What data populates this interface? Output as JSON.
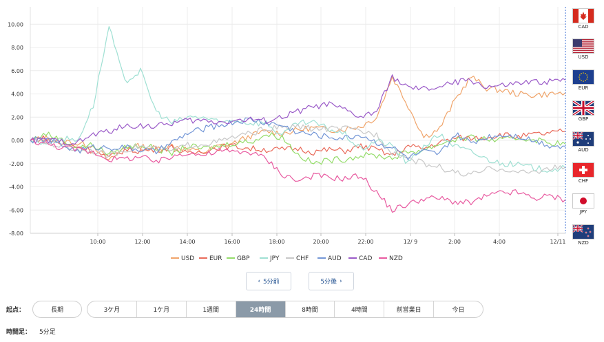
{
  "chart_data": {
    "type": "line",
    "yticks": [
      "10.00",
      "8.00",
      "6.00",
      "4.00",
      "2.00",
      "0.00",
      "-2.00",
      "-4.00",
      "-6.00",
      "-8.00"
    ],
    "ylim": [
      -8,
      11.5
    ],
    "xticks": [
      "10:00",
      "12:00",
      "14:00",
      "16:00",
      "18:00",
      "20:00",
      "22:00",
      "12/ 9",
      "2:00",
      "4:00",
      "12/11"
    ],
    "grid": true,
    "legend_position": "bottom",
    "series": [
      {
        "name": "USD",
        "color": "#f0a46a",
        "values": [
          0,
          0.2,
          0,
          -0.3,
          -0.4,
          -1.8,
          -0.6,
          -0.5,
          -0.7,
          -0.4,
          -0.8,
          -1.0,
          -0.5,
          -0.2,
          0.4,
          0.8,
          0.6,
          0.9,
          1.1,
          0.9,
          1.0,
          1.2,
          2.0,
          5.5,
          3.0,
          0.3,
          1.0,
          3.5,
          5.5,
          4.5,
          4.3,
          4.0,
          3.9,
          4.0,
          4.1
        ]
      },
      {
        "name": "EUR",
        "color": "#e96a5a",
        "values": [
          0,
          0.2,
          -0.3,
          -0.5,
          -0.9,
          -1.5,
          -0.8,
          -0.9,
          -0.8,
          -0.6,
          -1.2,
          -0.9,
          -0.6,
          -0.5,
          -0.7,
          -0.8,
          -0.8,
          -0.7,
          -1.0,
          -0.8,
          -0.9,
          -0.5,
          -0.8,
          -1.3,
          -0.5,
          -0.7,
          -0.2,
          0.2,
          0.2,
          0.3,
          0.5,
          0.3,
          0.5,
          0.6,
          0.8
        ]
      },
      {
        "name": "GBP",
        "color": "#94dc6a",
        "values": [
          0,
          0.6,
          0,
          -0.6,
          -0.4,
          -1.2,
          -0.6,
          -0.4,
          -0.7,
          -1.1,
          -0.5,
          -0.7,
          -0.5,
          -0.2,
          -0.1,
          0.5,
          0.3,
          -1.2,
          -2.0,
          -1.7,
          -1.6,
          -1.3,
          -1.3,
          -1.5,
          -1.0,
          -0.8,
          -0.3,
          0.1,
          0.2,
          0.1,
          0.0,
          0.2,
          0.1,
          -0.2,
          -0.3
        ]
      },
      {
        "name": "JPY",
        "color": "#9fe0d3",
        "values": [
          0,
          -0.2,
          0.2,
          0.0,
          3.0,
          9.8,
          5.0,
          6.0,
          2.5,
          1.5,
          2.0,
          2.0,
          1.5,
          1.8,
          1.5,
          1.5,
          0.4,
          1.5,
          1.5,
          1.0,
          0.5,
          -0.8,
          0,
          -0.5,
          -2.0,
          -0.5,
          0.5,
          -0.5,
          -1.0,
          -1.6,
          -2.0,
          -2.1,
          -2.4,
          -2.5,
          -2.4
        ]
      },
      {
        "name": "CHF",
        "color": "#c8c8c8",
        "values": [
          0,
          -0.2,
          -0.5,
          -0.8,
          -0.9,
          -1.3,
          -0.8,
          -0.5,
          -0.7,
          -0.9,
          -0.4,
          -0.3,
          -0.1,
          0.3,
          0.6,
          1.0,
          1.1,
          1.2,
          1.0,
          1.0,
          1.0,
          0.8,
          0.5,
          -1.0,
          -1.5,
          -2.0,
          -2.3,
          -2.8,
          -3.0,
          -2.5,
          -2.4,
          -2.8,
          -2.7,
          -2.4,
          -2.3
        ]
      },
      {
        "name": "AUD",
        "color": "#7396d6",
        "values": [
          0,
          0.1,
          -0.4,
          -0.9,
          -0.6,
          -0.6,
          -0.6,
          -0.8,
          -1.0,
          -0.2,
          0.6,
          1.0,
          1.3,
          1.6,
          1.8,
          1.5,
          1.3,
          0.7,
          0.5,
          0.3,
          0.2,
          0.5,
          -0.2,
          -0.6,
          -1.5,
          -1.0,
          -1.2,
          0.5,
          -0.2,
          0.3,
          0.5,
          0.4,
          0.0,
          -0.4,
          -0.5
        ]
      },
      {
        "name": "CAD",
        "color": "#9a5ac8",
        "values": [
          0,
          0,
          -0.1,
          -0.2,
          0.5,
          0.8,
          1.2,
          1.3,
          1.2,
          1.5,
          1.7,
          1.7,
          1.6,
          1.7,
          1.8,
          1.7,
          2.0,
          2.5,
          2.9,
          3.1,
          2.6,
          2.0,
          2.5,
          5.5,
          4.5,
          4.4,
          4.6,
          5.0,
          5.2,
          4.6,
          4.7,
          4.9,
          5.0,
          5.1,
          5.2
        ]
      },
      {
        "name": "NZD",
        "color": "#e85aa0",
        "values": [
          0,
          -0.3,
          -0.6,
          -0.8,
          -1.0,
          -1.6,
          -1.6,
          -1.4,
          -1.9,
          -1.4,
          -1.0,
          -1.3,
          -0.9,
          -1.0,
          -1.0,
          -1.6,
          -2.9,
          -3.5,
          -3.0,
          -3.2,
          -3.3,
          -3.0,
          -4.5,
          -6.0,
          -5.5,
          -5.0,
          -5.0,
          -5.3,
          -5.4,
          -4.8,
          -4.5,
          -4.5,
          -5.0,
          -4.8,
          -5.1
        ]
      }
    ]
  },
  "flags": [
    {
      "code": "CAD"
    },
    {
      "code": "USD"
    },
    {
      "code": "EUR"
    },
    {
      "code": "GBP"
    },
    {
      "code": "AUD"
    },
    {
      "code": "CHF"
    },
    {
      "code": "JPY"
    },
    {
      "code": "NZD"
    }
  ],
  "nav": {
    "prev_label": "5分前",
    "next_label": "5分後"
  },
  "start_point": {
    "label": "起点：",
    "first_option": "長期",
    "options": [
      "3ケ月",
      "1ケ月",
      "1週間",
      "24時間",
      "8時間",
      "4時間",
      "前営業日",
      "今日"
    ],
    "active": "24時間"
  },
  "timeframe": {
    "label": "時間足：",
    "value": "5分足"
  }
}
